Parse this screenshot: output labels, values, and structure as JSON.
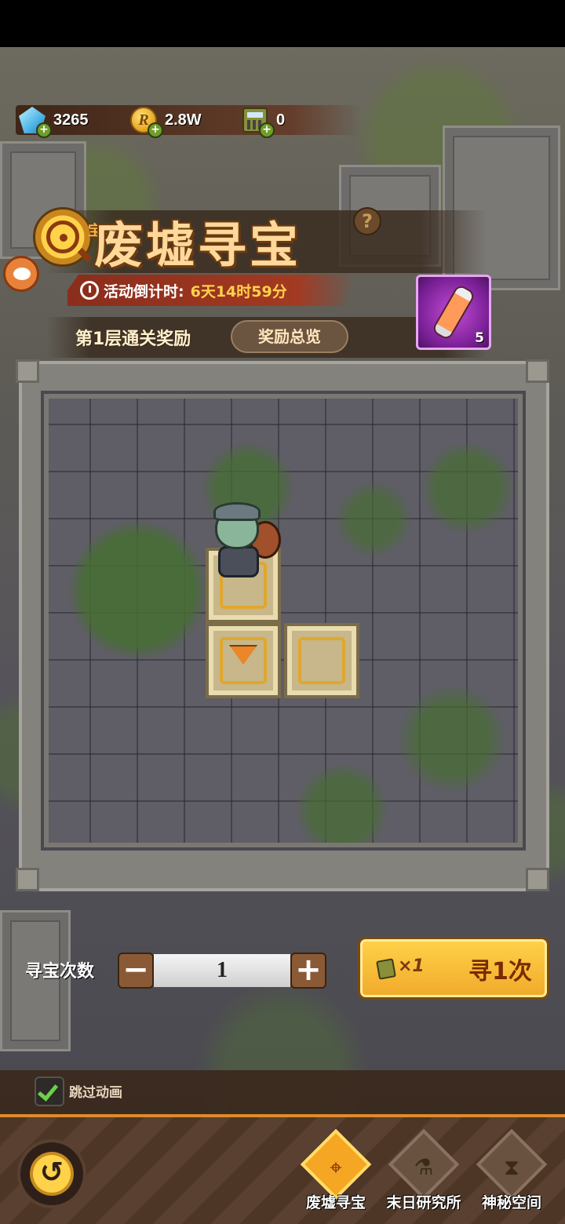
{
  "currencies": {
    "diamond": {
      "icon": "diamond-icon",
      "value": "3265"
    },
    "coin": {
      "icon": "coin-icon",
      "value": "2.8W"
    },
    "calculator": {
      "icon": "calculator-icon",
      "value": "0"
    }
  },
  "title": {
    "small_tag": "宝石!",
    "main": "废墟寻宝",
    "help": "?"
  },
  "countdown": {
    "label": "活动倒计时:",
    "value": "6天14时59分"
  },
  "reward": {
    "label": "第1层通关奖励",
    "overview_button": "奖励总览",
    "item_icon": "potion-tube-icon",
    "item_count": "5"
  },
  "controls": {
    "count_label": "寻宝次数",
    "minus": "−",
    "plus": "+",
    "count_value": "1",
    "cost": "×1",
    "search_button": "寻1次"
  },
  "skip": {
    "label": "跳过动画",
    "checked": true
  },
  "nav": {
    "back_glyph": "↺",
    "items": [
      {
        "label": "废墟寻宝",
        "icon": "magnifier-target-icon",
        "glyph": "⌖",
        "active": true
      },
      {
        "label": "末日研究所",
        "icon": "microscope-icon",
        "glyph": "⚗",
        "active": false
      },
      {
        "label": "神秘空间",
        "icon": "hourglass-icon",
        "glyph": "⧗",
        "active": false
      }
    ]
  },
  "colors": {
    "accent": "#f5a623",
    "countdown_bg": "#a33a22",
    "highlight": "#ffd24a"
  }
}
